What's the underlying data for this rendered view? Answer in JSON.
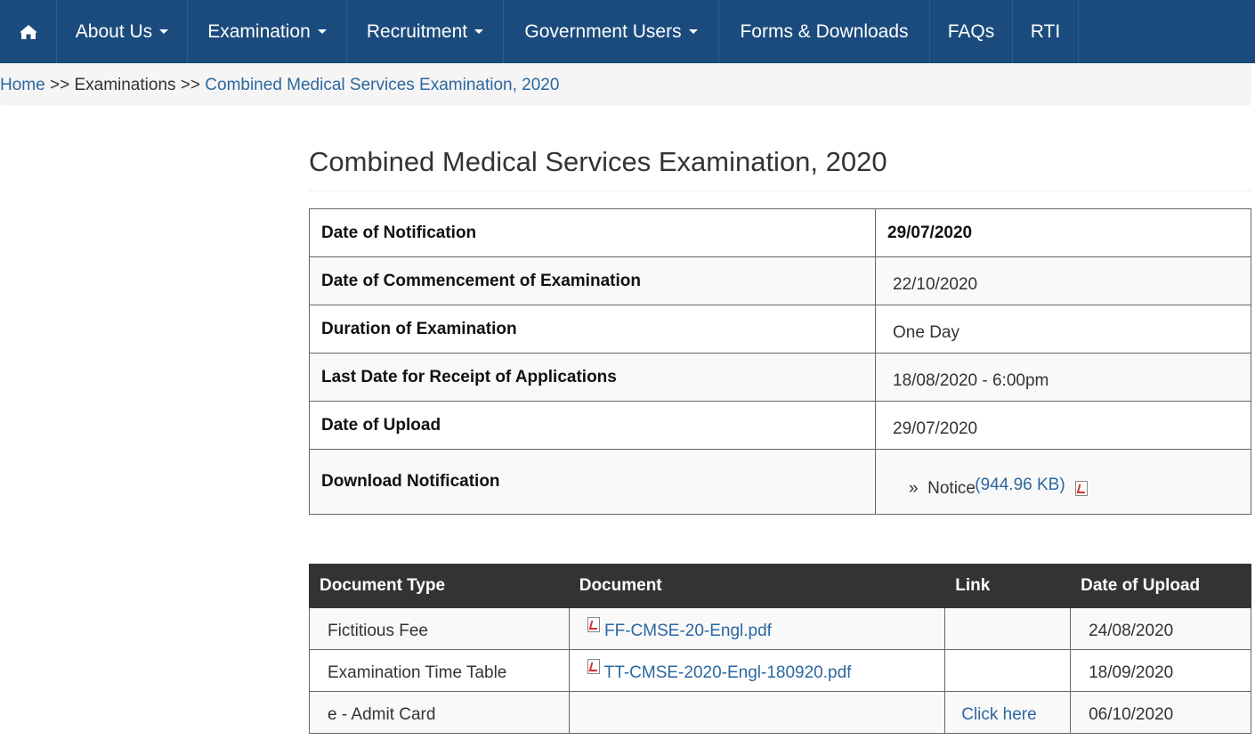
{
  "nav": {
    "items": [
      {
        "label": "About Us",
        "dropdown": true
      },
      {
        "label": "Examination",
        "dropdown": true
      },
      {
        "label": "Recruitment",
        "dropdown": true
      },
      {
        "label": "Government Users",
        "dropdown": true
      },
      {
        "label": "Forms & Downloads",
        "dropdown": false
      },
      {
        "label": "FAQs",
        "dropdown": false
      },
      {
        "label": "RTI",
        "dropdown": false
      }
    ]
  },
  "breadcrumb": {
    "home": "Home",
    "sep1": ">>",
    "examinations": "Examinations",
    "sep2": ">>",
    "current": "Combined Medical Services Examination, 2020"
  },
  "page_title": "Combined Medical Services Examination, 2020",
  "info": {
    "rows": [
      {
        "label": "Date of Notification",
        "value": "29/07/2020"
      },
      {
        "label": "Date of Commencement of Examination",
        "value": "22/10/2020"
      },
      {
        "label": "Duration of Examination",
        "value": "One Day"
      },
      {
        "label": "Last Date for Receipt of Applications",
        "value": "18/08/2020 - 6:00pm"
      },
      {
        "label": "Date of Upload",
        "value": "29/07/2020"
      }
    ],
    "download": {
      "label": "Download Notification",
      "bullet": "»",
      "text": "Notice",
      "size": "(944.96 KB)"
    }
  },
  "documents": {
    "headers": [
      "Document Type",
      "Document",
      "Link",
      "Date of Upload"
    ],
    "rows": [
      {
        "type": "Fictitious Fee",
        "document": "FF-CMSE-20-Engl.pdf",
        "link": "",
        "date": "24/08/2020"
      },
      {
        "type": "Examination Time Table",
        "document": "TT-CMSE-2020-Engl-180920.pdf",
        "link": "",
        "date": "18/09/2020"
      },
      {
        "type": "e - Admit Card",
        "document": "",
        "link": "Click here",
        "date": "06/10/2020"
      }
    ]
  },
  "colors": {
    "nav_bg": "#1b4b7d",
    "link": "#2c679f",
    "table_header_bg": "#333333",
    "pdf_icon": "#d32f2f"
  }
}
